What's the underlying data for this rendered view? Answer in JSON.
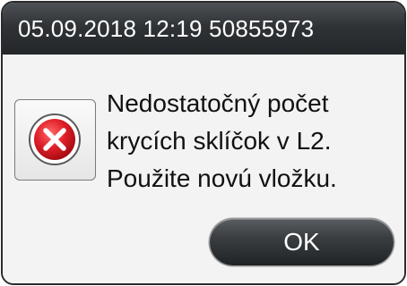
{
  "dialog": {
    "title": "05.09.2018 12:19 50855973",
    "icon": "error-x-icon",
    "message_lines": [
      "Nedostatočný počet",
      "krycích sklíčok v L2.",
      "Použite novú vložku."
    ],
    "ok_label": "OK"
  },
  "colors": {
    "titlebar": "#2f3336",
    "error_red": "#e0202a",
    "button": "#3a3e41"
  }
}
